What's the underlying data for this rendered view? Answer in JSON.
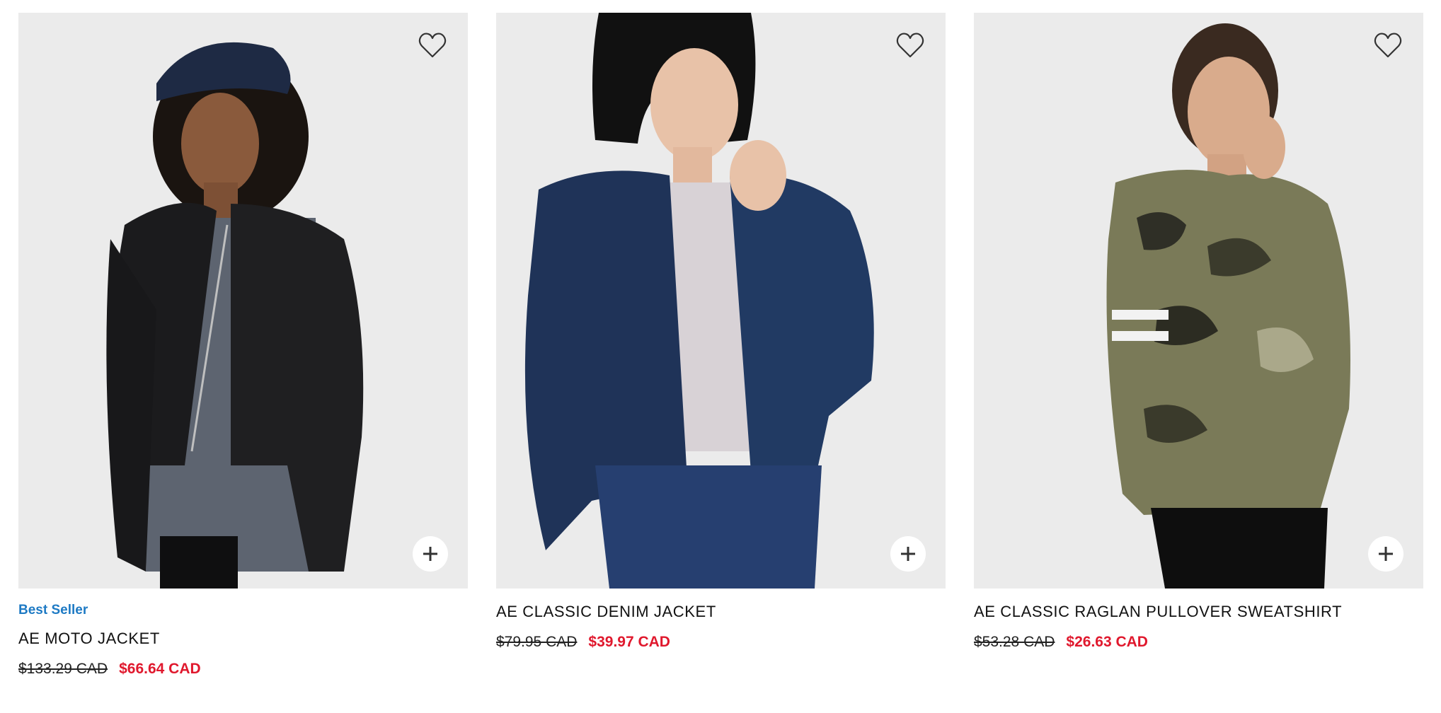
{
  "products": [
    {
      "badge": "Best Seller",
      "name": "AE MOTO JACKET",
      "original_price": "$133.29 CAD",
      "sale_price": "$66.64 CAD",
      "image": "model-in-black-leather-moto-jacket"
    },
    {
      "badge": "",
      "name": "AE CLASSIC DENIM JACKET",
      "original_price": "$79.95 CAD",
      "sale_price": "$39.97 CAD",
      "image": "model-in-dark-denim-jacket"
    },
    {
      "badge": "",
      "name": "AE CLASSIC RAGLAN PULLOVER SWEATSHIRT",
      "original_price": "$53.28 CAD",
      "sale_price": "$26.63 CAD",
      "image": "model-in-camo-sweatshirt"
    }
  ],
  "icons": {
    "favorite": "heart-outline-icon",
    "add": "plus-icon"
  },
  "colors": {
    "badge": "#1e7ac4",
    "sale_price": "#e0182d",
    "image_background": "#ebebeb"
  }
}
